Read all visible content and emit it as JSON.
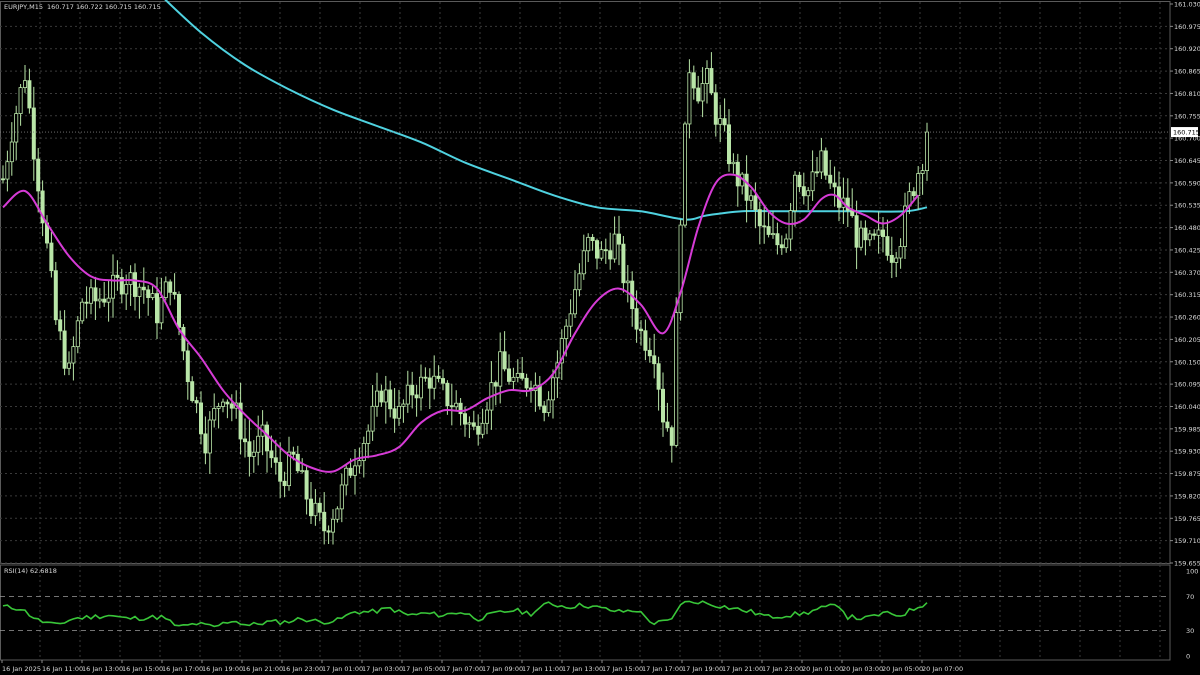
{
  "header": {
    "symbol": "EURJPY,M15",
    "ohlc": "160.717 160.722 160.715 160.715"
  },
  "price_panel": {
    "current_price_label": "160.715",
    "y_ticks": [
      "161.030",
      "160.975",
      "160.920",
      "160.865",
      "160.810",
      "160.755",
      "160.700",
      "160.645",
      "160.590",
      "160.535",
      "160.480",
      "160.425",
      "160.370",
      "160.315",
      "160.260",
      "160.205",
      "160.150",
      "160.095",
      "160.040",
      "159.985",
      "159.930",
      "159.875",
      "159.820",
      "159.765",
      "159.710",
      "159.655"
    ]
  },
  "rsi_panel": {
    "label": "RSI(14) 62.6818",
    "y_ticks": [
      "100",
      "70",
      "30",
      "0"
    ]
  },
  "x_ticks": [
    "16 Jan 2025",
    "16 Jan 11:00",
    "16 Jan 13:00",
    "16 Jan 15:00",
    "16 Jan 17:00",
    "16 Jan 19:00",
    "16 Jan 21:00",
    "16 Jan 23:00",
    "17 Jan 01:00",
    "17 Jan 03:00",
    "17 Jan 05:00",
    "17 Jan 07:00",
    "17 Jan 09:00",
    "17 Jan 11:00",
    "17 Jan 13:00",
    "17 Jan 15:00",
    "17 Jan 17:00",
    "17 Jan 19:00",
    "17 Jan 21:00",
    "17 Jan 23:00",
    "20 Jan 01:00",
    "20 Jan 03:00",
    "20 Jan 05:00",
    "20 Jan 07:00"
  ],
  "colors": {
    "background": "#000000",
    "grid": "#3a3a3a",
    "candle": "#b9e6a8",
    "ma_fast": "#d63bd6",
    "ma_slow": "#4fd2e0",
    "rsi": "#39c639",
    "text": "#dcdcdc"
  },
  "chart_data": {
    "type": "candlestick",
    "title": "EURJPY,M15",
    "ylim": [
      159.655,
      161.03
    ],
    "x_range": [
      "16 Jan 2025 09:00",
      "20 Jan 07:15"
    ],
    "ohlc_anchors": [
      [
        0,
        160.6
      ],
      [
        2,
        160.72
      ],
      [
        5,
        160.86
      ],
      [
        7,
        160.68
      ],
      [
        10,
        160.43
      ],
      [
        12,
        160.25
      ],
      [
        15,
        160.12
      ],
      [
        18,
        160.3
      ],
      [
        21,
        160.3
      ],
      [
        25,
        160.33
      ],
      [
        28,
        160.36
      ],
      [
        32,
        160.33
      ],
      [
        35,
        160.27
      ],
      [
        38,
        160.35
      ],
      [
        42,
        160.12
      ],
      [
        46,
        159.96
      ],
      [
        50,
        160.08
      ],
      [
        53,
        160.02
      ],
      [
        56,
        159.92
      ],
      [
        59,
        159.96
      ],
      [
        63,
        159.86
      ],
      [
        66,
        159.91
      ],
      [
        70,
        159.79
      ],
      [
        73,
        159.74
      ],
      [
        76,
        159.8
      ],
      [
        80,
        159.92
      ],
      [
        83,
        159.98
      ],
      [
        86,
        160.08
      ],
      [
        90,
        160.02
      ],
      [
        93,
        160.08
      ],
      [
        97,
        160.11
      ],
      [
        100,
        160.07
      ],
      [
        103,
        160.04
      ],
      [
        107,
        159.98
      ],
      [
        110,
        160.06
      ],
      [
        113,
        160.14
      ],
      [
        117,
        160.09
      ],
      [
        120,
        160.11
      ],
      [
        123,
        160.05
      ],
      [
        126,
        160.15
      ],
      [
        130,
        160.33
      ],
      [
        133,
        160.44
      ],
      [
        136,
        160.41
      ],
      [
        139,
        160.45
      ],
      [
        142,
        160.32
      ],
      [
        145,
        160.22
      ],
      [
        148,
        160.18
      ],
      [
        150,
        160.02
      ],
      [
        152,
        159.97
      ],
      [
        154,
        160.52
      ],
      [
        156,
        160.88
      ],
      [
        158,
        160.82
      ],
      [
        160,
        160.84
      ],
      [
        162,
        160.76
      ],
      [
        164,
        160.7
      ],
      [
        166,
        160.62
      ],
      [
        168,
        160.58
      ],
      [
        170,
        160.54
      ],
      [
        172,
        160.48
      ],
      [
        174,
        160.45
      ],
      [
        176,
        160.44
      ],
      [
        178,
        160.47
      ],
      [
        180,
        160.62
      ],
      [
        183,
        160.57
      ],
      [
        186,
        160.64
      ],
      [
        188,
        160.58
      ],
      [
        190,
        160.54
      ],
      [
        192,
        160.53
      ],
      [
        194,
        160.46
      ],
      [
        196,
        160.43
      ],
      [
        198,
        160.44
      ],
      [
        200,
        160.46
      ],
      [
        202,
        160.42
      ],
      [
        204,
        160.46
      ],
      [
        206,
        160.55
      ],
      [
        208,
        160.62
      ],
      [
        210,
        160.69
      ]
    ],
    "candle_count": 211,
    "last_close": 160.715,
    "series": [
      {
        "name": "MA fast",
        "points": [
          [
            0,
            160.53
          ],
          [
            5,
            160.57
          ],
          [
            10,
            160.49
          ],
          [
            15,
            160.41
          ],
          [
            20,
            160.36
          ],
          [
            25,
            160.35
          ],
          [
            30,
            160.35
          ],
          [
            35,
            160.33
          ],
          [
            40,
            160.23
          ],
          [
            45,
            160.16
          ],
          [
            50,
            160.08
          ],
          [
            55,
            160.02
          ],
          [
            60,
            159.97
          ],
          [
            65,
            159.92
          ],
          [
            70,
            159.89
          ],
          [
            75,
            159.88
          ],
          [
            80,
            159.91
          ],
          [
            85,
            159.92
          ],
          [
            90,
            159.94
          ],
          [
            95,
            160.0
          ],
          [
            100,
            160.03
          ],
          [
            105,
            160.03
          ],
          [
            110,
            160.06
          ],
          [
            115,
            160.08
          ],
          [
            120,
            160.08
          ],
          [
            125,
            160.12
          ],
          [
            130,
            160.22
          ],
          [
            135,
            160.3
          ],
          [
            140,
            160.33
          ],
          [
            145,
            160.29
          ],
          [
            150,
            160.22
          ],
          [
            154,
            160.32
          ],
          [
            158,
            160.48
          ],
          [
            162,
            160.59
          ],
          [
            166,
            160.61
          ],
          [
            170,
            160.58
          ],
          [
            174,
            160.52
          ],
          [
            178,
            160.49
          ],
          [
            182,
            160.5
          ],
          [
            186,
            160.55
          ],
          [
            189,
            160.56
          ],
          [
            192,
            160.53
          ],
          [
            196,
            160.51
          ],
          [
            200,
            160.49
          ],
          [
            204,
            160.51
          ],
          [
            208,
            160.56
          ]
        ]
      },
      {
        "name": "MA slow",
        "points": [
          [
            35,
            161.06
          ],
          [
            45,
            160.96
          ],
          [
            55,
            160.88
          ],
          [
            65,
            160.82
          ],
          [
            75,
            160.77
          ],
          [
            85,
            160.73
          ],
          [
            95,
            160.69
          ],
          [
            105,
            160.64
          ],
          [
            115,
            160.6
          ],
          [
            125,
            160.56
          ],
          [
            135,
            160.53
          ],
          [
            145,
            160.52
          ],
          [
            155,
            160.5
          ],
          [
            160,
            160.51
          ],
          [
            168,
            160.52
          ],
          [
            176,
            160.52
          ],
          [
            185,
            160.52
          ],
          [
            195,
            160.52
          ],
          [
            205,
            160.52
          ],
          [
            210,
            160.53
          ]
        ]
      },
      {
        "name": "RSI(14)",
        "points": [
          [
            0,
            58
          ],
          [
            4,
            56
          ],
          [
            8,
            42
          ],
          [
            12,
            36
          ],
          [
            16,
            44
          ],
          [
            20,
            46
          ],
          [
            24,
            48
          ],
          [
            28,
            44
          ],
          [
            32,
            45
          ],
          [
            36,
            46
          ],
          [
            40,
            34
          ],
          [
            44,
            38
          ],
          [
            48,
            34
          ],
          [
            52,
            42
          ],
          [
            56,
            36
          ],
          [
            60,
            40
          ],
          [
            64,
            40
          ],
          [
            68,
            44
          ],
          [
            72,
            40
          ],
          [
            76,
            42
          ],
          [
            80,
            52
          ],
          [
            84,
            52
          ],
          [
            88,
            56
          ],
          [
            92,
            48
          ],
          [
            96,
            50
          ],
          [
            100,
            48
          ],
          [
            104,
            52
          ],
          [
            108,
            44
          ],
          [
            112,
            50
          ],
          [
            116,
            54
          ],
          [
            120,
            50
          ],
          [
            124,
            62
          ],
          [
            128,
            58
          ],
          [
            132,
            60
          ],
          [
            136,
            56
          ],
          [
            140,
            52
          ],
          [
            144,
            54
          ],
          [
            148,
            38
          ],
          [
            152,
            42
          ],
          [
            154,
            62
          ],
          [
            158,
            64
          ],
          [
            162,
            60
          ],
          [
            166,
            56
          ],
          [
            170,
            52
          ],
          [
            174,
            46
          ],
          [
            178,
            48
          ],
          [
            182,
            50
          ],
          [
            186,
            56
          ],
          [
            190,
            60
          ],
          [
            192,
            46
          ],
          [
            196,
            44
          ],
          [
            200,
            50
          ],
          [
            204,
            48
          ],
          [
            208,
            58
          ],
          [
            210,
            62.68
          ]
        ]
      }
    ],
    "rsi": {
      "label": "RSI(14) 62.6818",
      "ylim": [
        0,
        100
      ],
      "levels": [
        70,
        30
      ]
    }
  }
}
